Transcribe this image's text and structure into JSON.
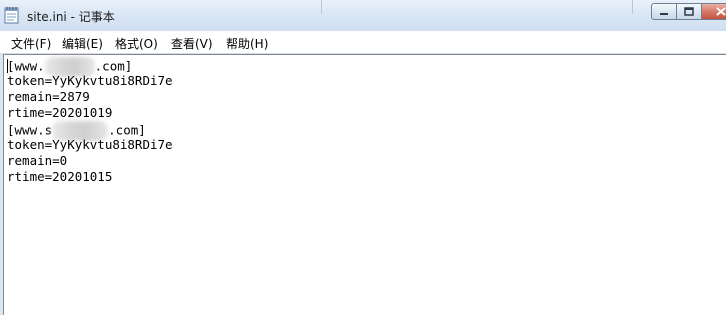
{
  "window": {
    "title": "site.ini - 记事本"
  },
  "menu": {
    "items": [
      {
        "label": "文件(F)"
      },
      {
        "label": "编辑(E)"
      },
      {
        "label": "格式(O)"
      },
      {
        "label": "查看(V)"
      },
      {
        "label": "帮助(H)"
      }
    ]
  },
  "document": {
    "lines": [
      {
        "prefix": "[www.",
        "suffix": ".com]",
        "redacted": true
      },
      {
        "text": "token=YyKykvtu8i8RDi7e"
      },
      {
        "text": "remain=2879"
      },
      {
        "text": "rtime=20201019"
      },
      {
        "prefix": "[www.s",
        "suffix": ".com]",
        "redacted": true
      },
      {
        "text": "token=YyKykvtu8i8RDi7e"
      },
      {
        "text": "remain=0"
      },
      {
        "text": "rtime=20201015"
      }
    ]
  },
  "icons": {
    "app": "notepad-icon",
    "minimize": "minimize-icon",
    "maximize": "maximize-icon",
    "close": "close-icon"
  }
}
